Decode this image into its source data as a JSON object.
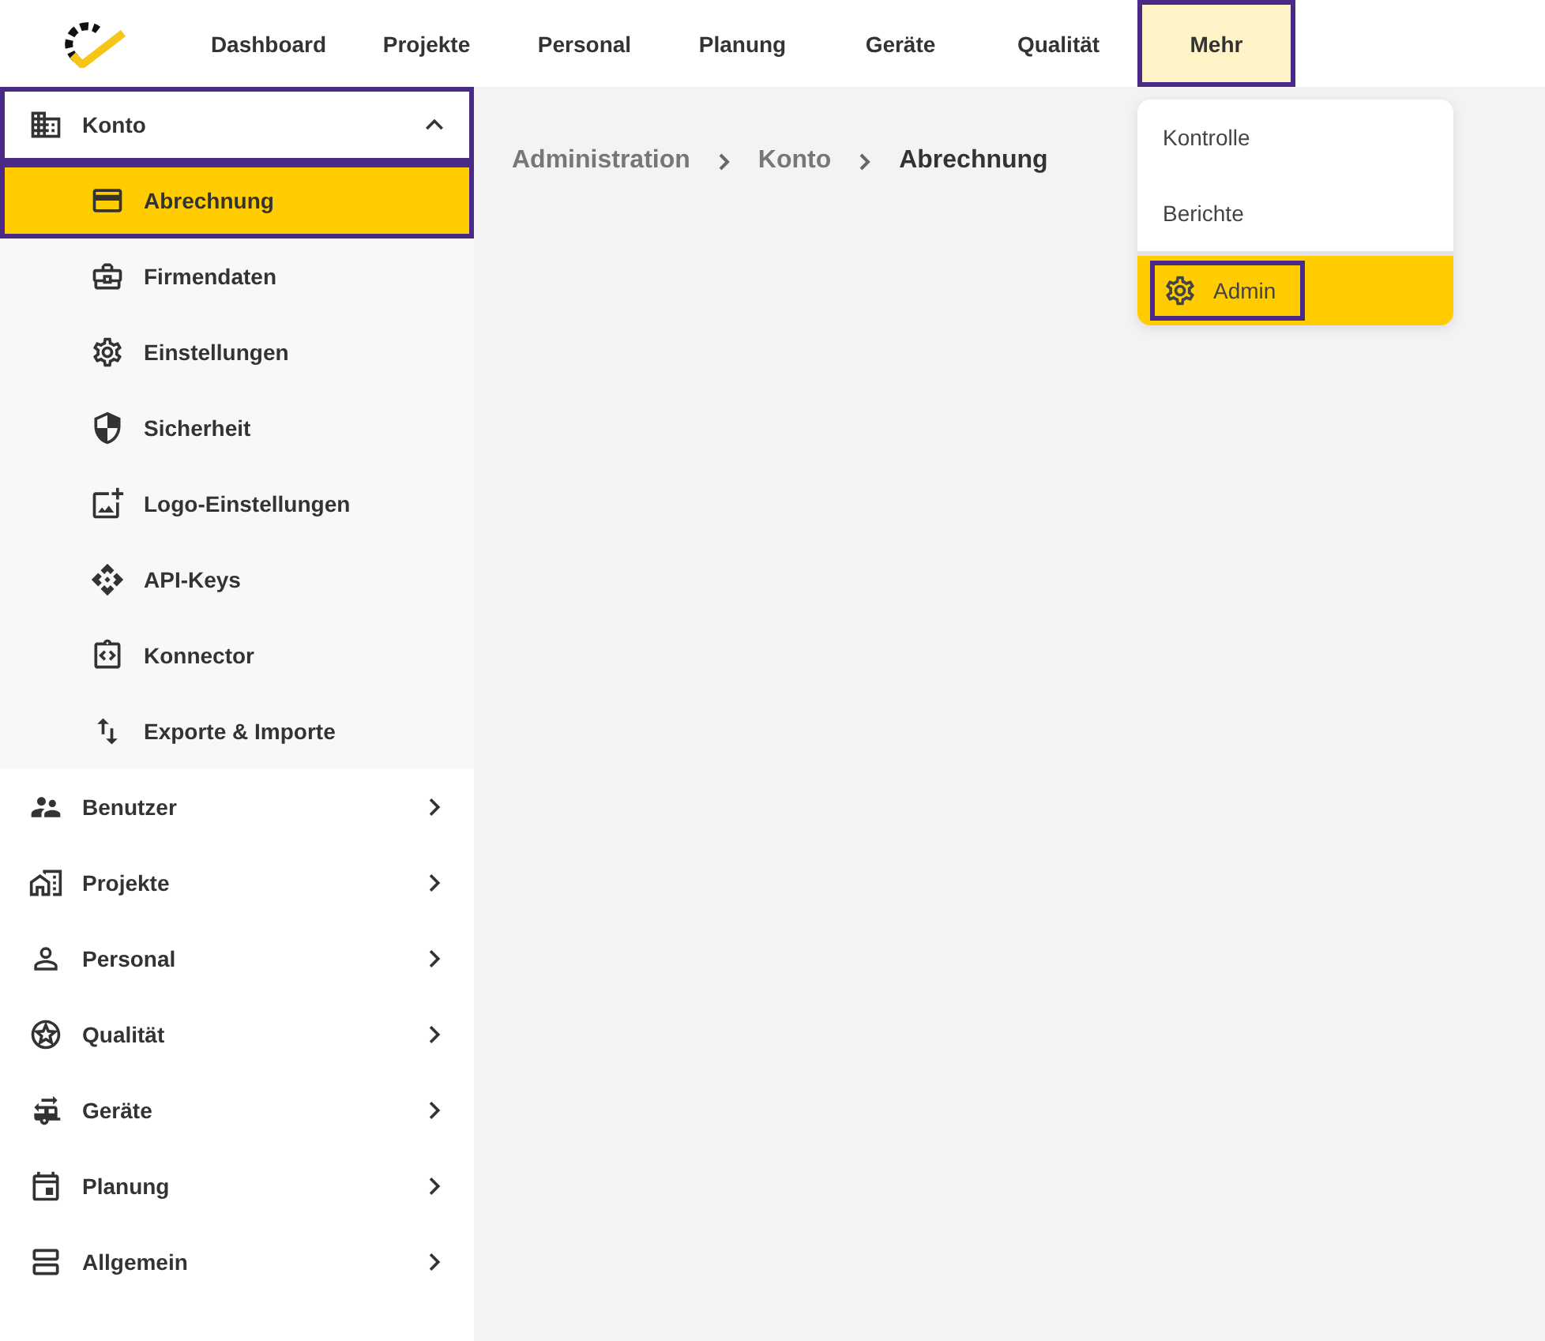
{
  "nav": [
    {
      "label": "Dashboard",
      "selected": false,
      "outlined": false
    },
    {
      "label": "Projekte",
      "selected": false,
      "outlined": false
    },
    {
      "label": "Personal",
      "selected": false,
      "outlined": false
    },
    {
      "label": "Planung",
      "selected": false,
      "outlined": false
    },
    {
      "label": "Geräte",
      "selected": false,
      "outlined": false
    },
    {
      "label": "Qualität",
      "selected": false,
      "outlined": false
    },
    {
      "label": "Mehr",
      "selected": true,
      "outlined": true
    }
  ],
  "sidebar": {
    "groups": [
      {
        "label": "Konto",
        "expanded": true,
        "outlined": true,
        "children": [
          {
            "label": "Abrechnung",
            "selected": true,
            "outlined": true
          },
          {
            "label": "Firmendaten",
            "selected": false,
            "outlined": false
          },
          {
            "label": "Einstellungen",
            "selected": false,
            "outlined": false
          },
          {
            "label": "Sicherheit",
            "selected": false,
            "outlined": false
          },
          {
            "label": "Logo-Einstellungen",
            "selected": false,
            "outlined": false
          },
          {
            "label": "API-Keys",
            "selected": false,
            "outlined": false
          },
          {
            "label": "Konnector",
            "selected": false,
            "outlined": false
          },
          {
            "label": "Exporte & Importe",
            "selected": false,
            "outlined": false
          }
        ]
      },
      {
        "label": "Benutzer",
        "expanded": false,
        "outlined": false
      },
      {
        "label": "Projekte",
        "expanded": false,
        "outlined": false
      },
      {
        "label": "Personal",
        "expanded": false,
        "outlined": false
      },
      {
        "label": "Qualität",
        "expanded": false,
        "outlined": false
      },
      {
        "label": "Geräte",
        "expanded": false,
        "outlined": false
      },
      {
        "label": "Planung",
        "expanded": false,
        "outlined": false
      },
      {
        "label": "Allgemein",
        "expanded": false,
        "outlined": false
      }
    ]
  },
  "breadcrumb": [
    {
      "label": "Administration",
      "current": false
    },
    {
      "label": "Konto",
      "current": false
    },
    {
      "label": "Abrechnung",
      "current": true
    }
  ],
  "dropdown": {
    "items": [
      {
        "label": "Kontrolle",
        "selected": false,
        "outlined": false
      },
      {
        "label": "Berichte",
        "selected": false,
        "outlined": false
      },
      {
        "label": "Admin",
        "selected": true,
        "outlined": true
      }
    ]
  }
}
